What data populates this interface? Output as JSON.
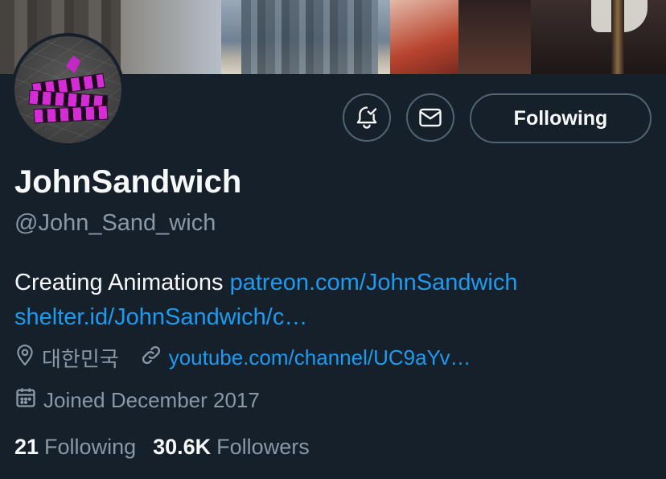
{
  "profile": {
    "display_name": "JohnSandwich",
    "handle": "@John_Sand_wich",
    "bio_text": "Creating Animations ",
    "bio_link_1": "patreon.com/JohnSandwich",
    "bio_link_2": "shelter.id/JohnSandwich/c…",
    "location": "대한민국",
    "website": "youtube.com/channel/UC9aYv…",
    "joined": "Joined December 2017"
  },
  "actions": {
    "notify_icon": "bell-check-icon",
    "message_icon": "envelope-icon",
    "following_label": "Following"
  },
  "stats": {
    "following_count": "21",
    "following_label": "Following",
    "followers_count": "30.6K",
    "followers_label": "Followers"
  },
  "icons": {
    "location": "location-pin-icon",
    "link": "link-icon",
    "calendar": "calendar-icon"
  },
  "colors": {
    "background": "#15202b",
    "text": "#f7f9f9",
    "secondary_text": "#8b98a5",
    "link": "#1d9bf0",
    "border": "#536471"
  }
}
